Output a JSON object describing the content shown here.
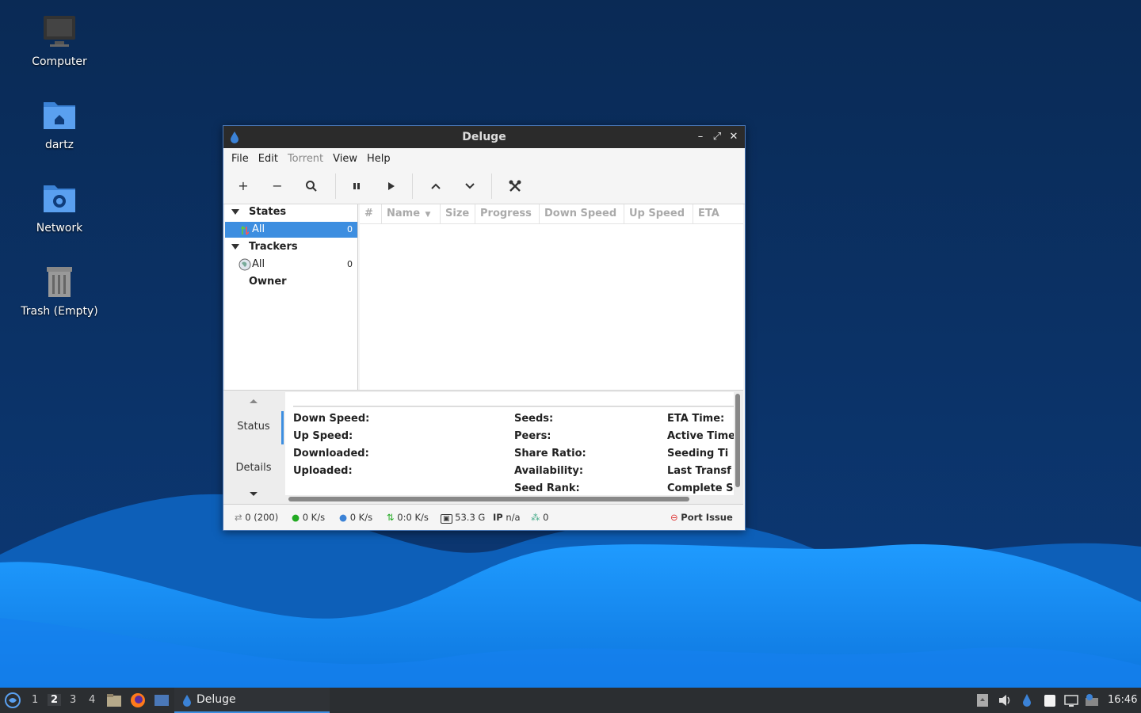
{
  "desktop": {
    "icons": [
      {
        "label": "Computer"
      },
      {
        "label": "dartz"
      },
      {
        "label": "Network"
      },
      {
        "label": "Trash (Empty)"
      }
    ]
  },
  "window": {
    "title": "Deluge",
    "menu": [
      "File",
      "Edit",
      "Torrent",
      "View",
      "Help"
    ],
    "toolbar": {
      "add": "+",
      "remove": "−",
      "find": "⌕",
      "pause": "⏸",
      "resume": "▶",
      "up": "⌃",
      "down": "⌄",
      "prefs": "✖"
    },
    "sidebar": {
      "states_header": "States",
      "states_all_label": "All",
      "states_all_count": "0",
      "trackers_header": "Trackers",
      "trackers_all_label": "All",
      "trackers_all_count": "0",
      "owner_label": "Owner"
    },
    "columns": [
      "#",
      "Name",
      "Size",
      "Progress",
      "Down Speed",
      "Up Speed",
      "ETA"
    ],
    "details": {
      "tabs": [
        "Status",
        "Details"
      ],
      "col1": [
        "Down Speed:",
        "Up Speed:",
        "Downloaded:",
        "Uploaded:"
      ],
      "col2": [
        "Seeds:",
        "Peers:",
        "Share Ratio:",
        "Availability:",
        "Seed Rank:"
      ],
      "col3": [
        "ETA Time:",
        "Active Time",
        "Seeding Ti",
        "Last Transf",
        "Complete S"
      ]
    },
    "statusbar": {
      "connections": "0 (200)",
      "down_speed": "0 K/s",
      "up_speed": "0 K/s",
      "protocol": "0:0 K/s",
      "free_space": "53.3 G",
      "ip_label": "IP",
      "ip_value": "n/a",
      "dht": "0",
      "port_issue": "Port Issue"
    }
  },
  "taskbar": {
    "workspaces": [
      "1",
      "2",
      "3",
      "4"
    ],
    "active_workspace": "2",
    "task_label": "Deluge",
    "clock": "16:46"
  },
  "colors": {
    "accent": "#3d8ee0",
    "desktop_bg": "#0b2a55",
    "wave": "#1a8cf0"
  }
}
